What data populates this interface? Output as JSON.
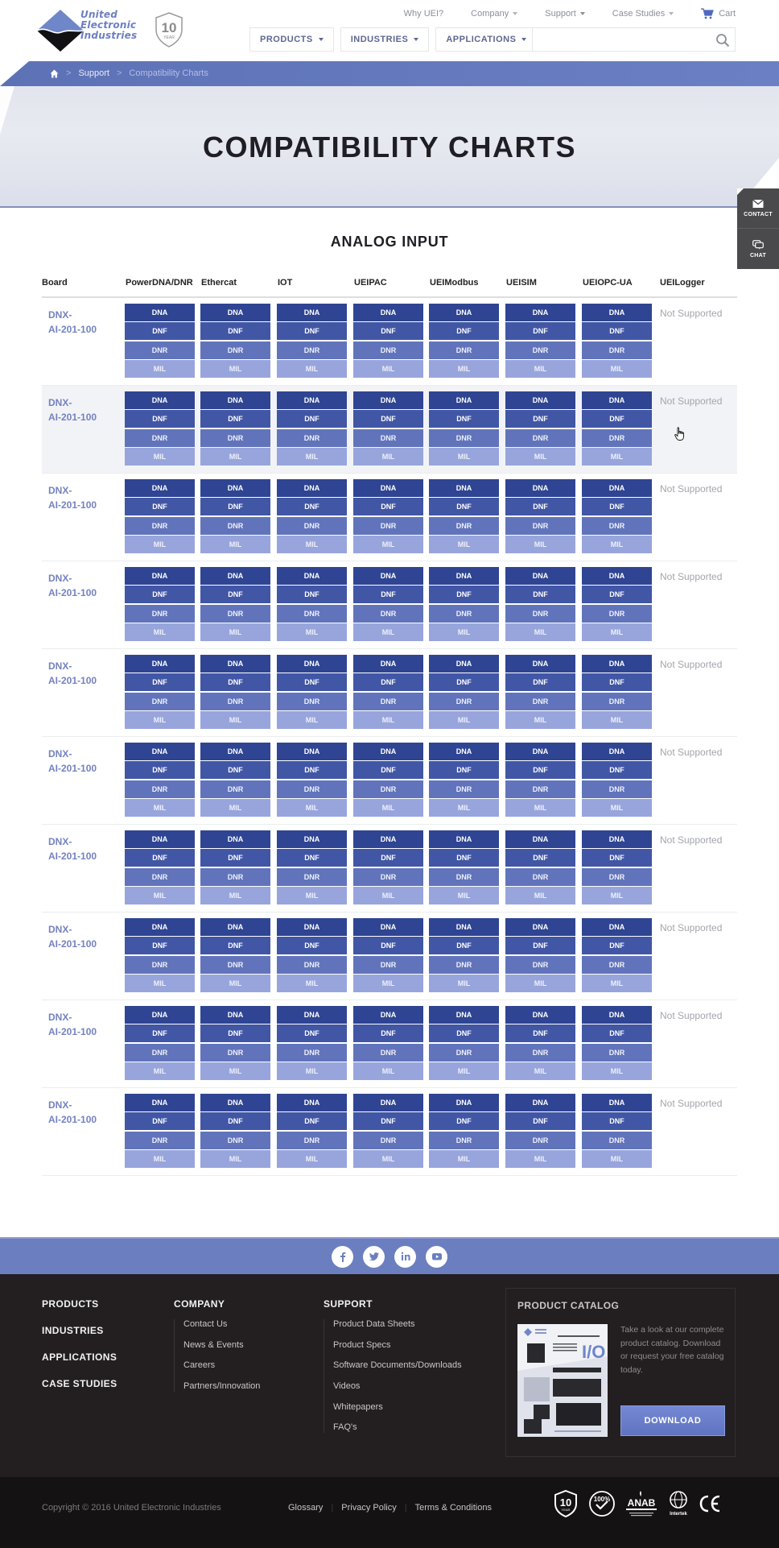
{
  "header": {
    "logo_lines": [
      "United",
      "Electronic",
      "Industries"
    ],
    "badge": {
      "number": "10",
      "word": "YEAR"
    },
    "top_nav": [
      {
        "label": "Why UEI?",
        "has_caret": false
      },
      {
        "label": "Company",
        "has_caret": true
      },
      {
        "label": "Support",
        "has_caret": true
      },
      {
        "label": "Case Studies",
        "has_caret": true
      }
    ],
    "cart_label": "Cart",
    "main_nav": [
      {
        "label": "PRODUCTS"
      },
      {
        "label": "INDUSTRIES"
      },
      {
        "label": "APPLICATIONS"
      }
    ],
    "search": {
      "value": "",
      "placeholder": ""
    }
  },
  "breadcrumb": {
    "items": [
      {
        "label": "Support"
      },
      {
        "label": "Compatibility Charts"
      }
    ],
    "separator": ">"
  },
  "hero": {
    "title": "COMPATIBILITY CHARTS"
  },
  "side_tabs": [
    {
      "label": "CONTACT",
      "icon": "envelope-icon"
    },
    {
      "label": "CHAT",
      "icon": "chat-bubbles-icon"
    }
  ],
  "section": {
    "title": "ANALOG INPUT"
  },
  "table": {
    "columns": [
      "Board",
      "PowerDNA/DNR",
      "Ethercat",
      "IOT",
      "UEIPAC",
      "UEIModbus",
      "UEISIM",
      "UEIOPC-UA",
      "UEILogger"
    ],
    "chip_labels": [
      "DNA",
      "DNF",
      "DNR",
      "MIL"
    ],
    "chip_colors": [
      "#2f4593",
      "#4156a5",
      "#6174bb",
      "#98a5dc"
    ],
    "rows": [
      {
        "board": "DNX-AI-201-100",
        "board_line1": "DNX-",
        "board_line2": "AI-201-100",
        "logger": "Not Supported"
      },
      {
        "board": "DNX-AI-201-100",
        "board_line1": "DNX-",
        "board_line2": "AI-201-100",
        "logger": "Not Supported",
        "highlighted": true
      },
      {
        "board": "DNX-AI-201-100",
        "board_line1": "DNX-",
        "board_line2": "AI-201-100",
        "logger": "Not Supported"
      },
      {
        "board": "DNX-AI-201-100",
        "board_line1": "DNX-",
        "board_line2": "AI-201-100",
        "logger": "Not Supported"
      },
      {
        "board": "DNX-AI-201-100",
        "board_line1": "DNX-",
        "board_line2": "AI-201-100",
        "logger": "Not Supported"
      },
      {
        "board": "DNX-AI-201-100",
        "board_line1": "DNX-",
        "board_line2": "AI-201-100",
        "logger": "Not Supported"
      },
      {
        "board": "DNX-AI-201-100",
        "board_line1": "DNX-",
        "board_line2": "AI-201-100",
        "logger": "Not Supported"
      },
      {
        "board": "DNX-AI-201-100",
        "board_line1": "DNX-",
        "board_line2": "AI-201-100",
        "logger": "Not Supported"
      },
      {
        "board": "DNX-AI-201-100",
        "board_line1": "DNX-",
        "board_line2": "AI-201-100",
        "logger": "Not Supported"
      },
      {
        "board": "DNX-AI-201-100",
        "board_line1": "DNX-",
        "board_line2": "AI-201-100",
        "logger": "Not Supported"
      }
    ]
  },
  "social": [
    "facebook",
    "twitter",
    "linkedin",
    "youtube"
  ],
  "footer": {
    "main_links": [
      "PRODUCTS",
      "INDUSTRIES",
      "APPLICATIONS",
      "CASE STUDIES"
    ],
    "company": {
      "heading": "COMPANY",
      "links": [
        "Contact Us",
        "News & Events",
        "Careers",
        "Partners/Innovation"
      ]
    },
    "support": {
      "heading": "SUPPORT",
      "links": [
        "Product Data Sheets",
        "Product Specs",
        "Software Documents/Downloads",
        "Videos",
        "Whitepapers",
        "FAQ's"
      ]
    },
    "catalog": {
      "heading": "PRODUCT CATALOG",
      "description": "Take a look at our complete product catalog. Download or request your free catalog today.",
      "button": "DOWNLOAD",
      "thumb_big_text": "I/O"
    },
    "copyright": "Copyright © 2016 United Electronic Industries",
    "legal_links": [
      "Glossary",
      "Privacy Policy",
      "Terms & Conditions"
    ],
    "certifications": [
      "10 Year Warranty",
      "100% Test Verified",
      "ANAB Accredited",
      "Intertek",
      "CE"
    ]
  },
  "colors": {
    "brand_blue": "#6b7fc0",
    "link_blue": "#7482c1",
    "footer_bg": "#231f20"
  }
}
